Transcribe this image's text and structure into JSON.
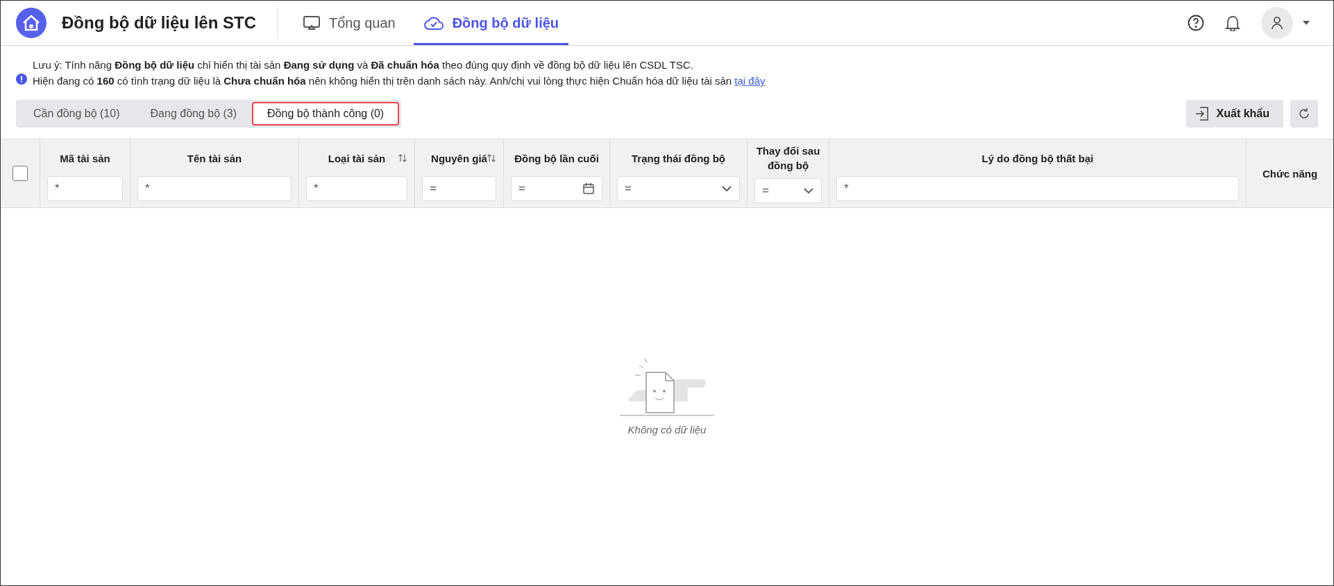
{
  "header": {
    "title": "Đồng bộ dữ liệu lên STC",
    "nav": [
      {
        "label": "Tổng quan",
        "kind": "monitor",
        "selected": false
      },
      {
        "label": "Đồng bộ dữ liệu",
        "kind": "cloud",
        "selected": true
      }
    ]
  },
  "notice": {
    "line_1": "Lưu ý: Tính năng **Đồng bộ dữ liệu** chỉ hiển thị tài sản **Đang sử dụng** và **Đã chuẩn hóa** theo đúng quy định về đồng bộ dữ liệu lên CSDL TSC.",
    "line_2": "Hiện đang có **160** có tình trạng dữ liệu là **Chưa chuẩn hóa** nên không hiển thị trên danh sách này. Anh/chị vui lòng thực hiện Chuẩn hóa dữ liệu tài sản",
    "link": "tại đây"
  },
  "tabs": [
    {
      "label": "Cần đồng bộ (10)",
      "selected": false
    },
    {
      "label": "Đang đồng bộ (3)",
      "selected": false
    },
    {
      "label": "Đồng bộ thành công (0)",
      "selected": true
    }
  ],
  "export_button": "Xuất khẩu",
  "table": {
    "select_all_checked": false,
    "columns": [
      {
        "label": "Mã tài sản",
        "sortable": false,
        "filter": {
          "kind": "text",
          "operator": "*"
        }
      },
      {
        "label": "Tên tài sản",
        "sortable": false,
        "filter": {
          "kind": "text",
          "operator": "*"
        }
      },
      {
        "label": "Loại tài sản",
        "sortable": true,
        "filter": {
          "kind": "text",
          "operator": "*"
        }
      },
      {
        "label": "Nguyên giá",
        "sortable": true,
        "filter": {
          "kind": "text",
          "operator": "="
        }
      },
      {
        "label": "Đồng bộ lần cuối",
        "sortable": false,
        "filter": {
          "kind": "date",
          "operator": "="
        }
      },
      {
        "label": "Trạng thái đồng bộ",
        "sortable": false,
        "filter": {
          "kind": "select",
          "operator": "="
        }
      },
      {
        "label": "Thay đổi sau đồng bộ",
        "sortable": false,
        "filter": {
          "kind": "select",
          "operator": "="
        }
      },
      {
        "label": "Lý do đồng bộ thất bại",
        "sortable": false,
        "filter": {
          "kind": "text",
          "operator": "*"
        }
      },
      {
        "label": "Chức năng",
        "sortable": false,
        "filter": {
          "kind": "none"
        }
      }
    ],
    "empty_message": "Không có dữ liệu"
  }
}
